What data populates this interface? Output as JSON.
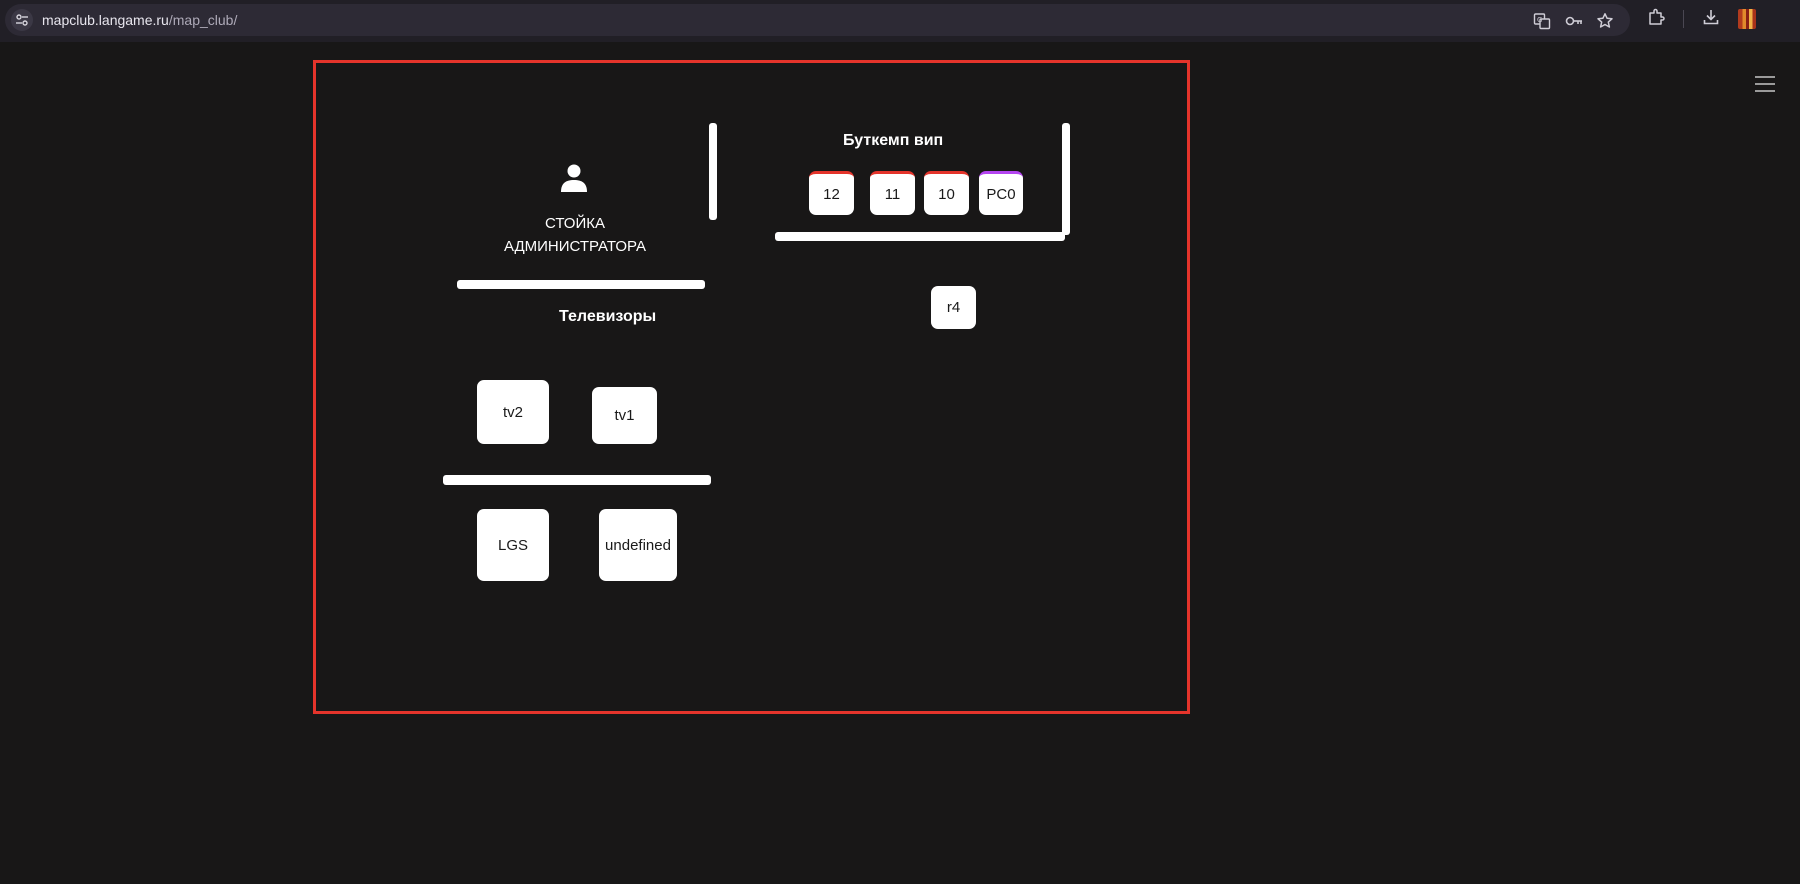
{
  "browser": {
    "url_host": "mapclub.langame.ru",
    "url_path": "/map_club/"
  },
  "map": {
    "admin_desk": {
      "line1": "СТОЙКА",
      "line2": "АДМИНИСТРАТОРА"
    },
    "zones": {
      "bootcamp_title": "Буткемп вип",
      "tv_title": "Телевизоры"
    },
    "bootcamp_pcs": [
      "12",
      "11",
      "10",
      "PC0"
    ],
    "pc_r4": "r4",
    "tvs": [
      "tv2",
      "tv1"
    ],
    "bottom_devices": [
      "LGS",
      "undefined"
    ],
    "colors": {
      "frame": "#e4342b",
      "busy": "#e4342b",
      "reserved": "#b445f0",
      "background": "#181717"
    }
  }
}
